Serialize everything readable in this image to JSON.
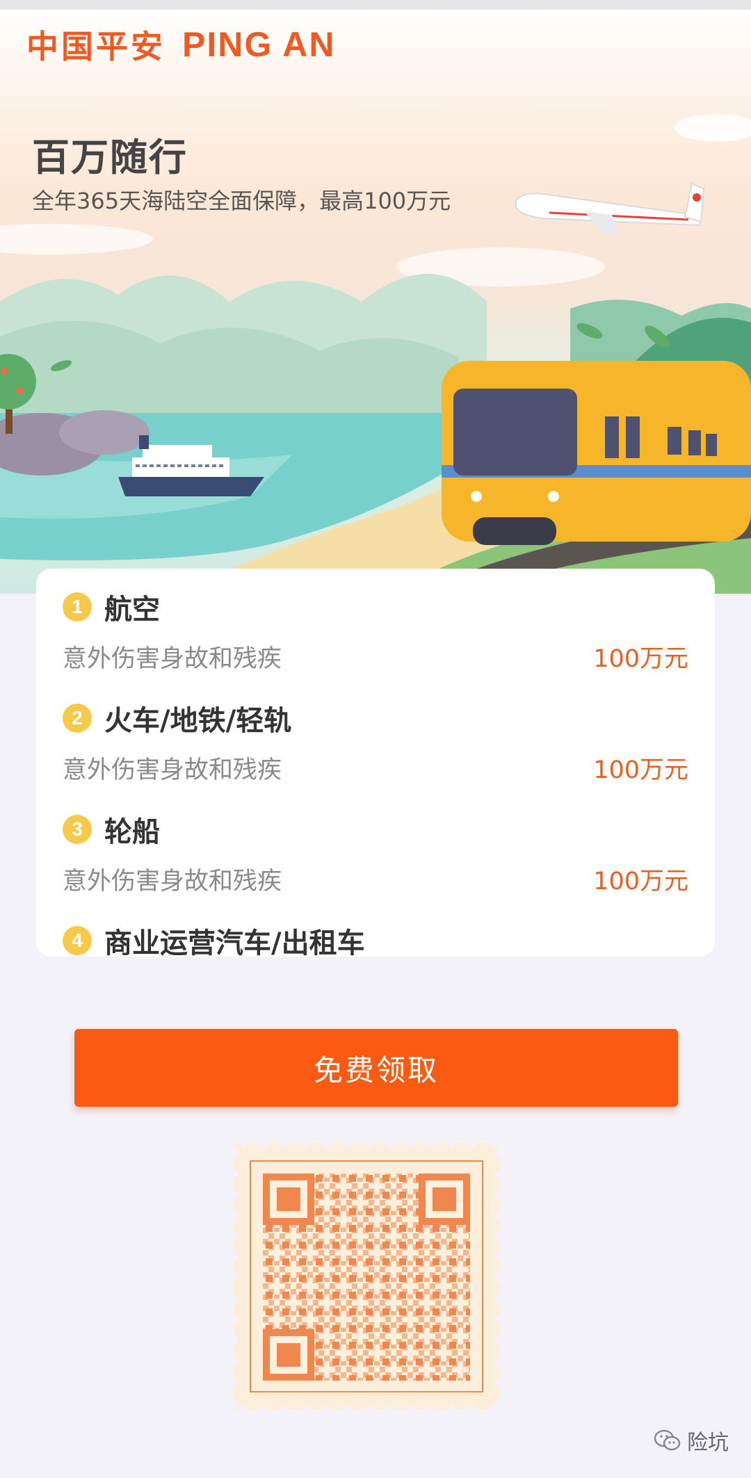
{
  "brand": {
    "name_cn": "中国平安",
    "name_en": "PING AN",
    "color": "#f05a22"
  },
  "hero": {
    "title": "百万随行",
    "subtitle": "全年365天海陆空全面保障，最高100万元"
  },
  "coverage": {
    "items": [
      {
        "num": "1",
        "title": "航空",
        "desc": "意外伤害身故和残疾",
        "amount": "100万元"
      },
      {
        "num": "2",
        "title": "火车/地铁/轻轨",
        "desc": "意外伤害身故和残疾",
        "amount": "100万元"
      },
      {
        "num": "3",
        "title": "轮船",
        "desc": "意外伤害身故和残疾",
        "amount": "100万元"
      },
      {
        "num": "4",
        "title": "商业运营汽车/出租车"
      }
    ]
  },
  "cta": {
    "label": "免费领取",
    "color": "#fb5a12"
  },
  "qr": {
    "icon": "qr-code-icon",
    "color": "#f0874e"
  },
  "watermark": {
    "text": "险坑",
    "icon": "wechat-icon"
  }
}
